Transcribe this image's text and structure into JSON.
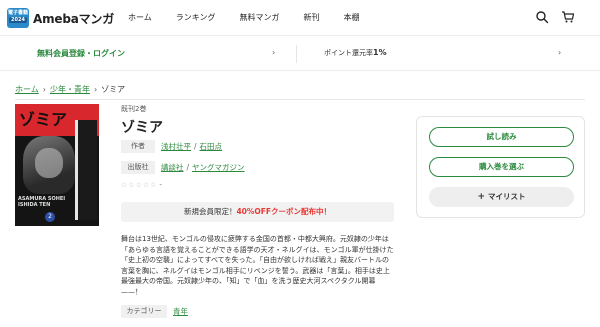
{
  "header": {
    "logo_badge_top": "電子書籍",
    "logo_badge_bottom": "2024",
    "logo_text": "Amebaマンガ",
    "nav": [
      "ホーム",
      "ランキング",
      "無料マンガ",
      "新刊",
      "本棚"
    ],
    "icons": [
      "search-icon",
      "cart-icon"
    ]
  },
  "promo": {
    "left": "無料会員登録・ログイン",
    "right_prefix": "ポイント還元率",
    "right_value": "1",
    "right_suffix": "%"
  },
  "breadcrumb": {
    "home": "ホーム",
    "category": "少年・青年",
    "current": "ゾミア"
  },
  "book": {
    "cover_title": "ゾミア",
    "cover_author_line1": "ASAMURA SOHEI",
    "cover_author_line2": "ISHIDA TEN",
    "cover_volume": "2",
    "volumes": "既刊2巻",
    "title": "ゾミア",
    "author_label": "作者",
    "author1": "浅村壮平",
    "author2": "石田点",
    "publisher_label": "出版社",
    "publisher": "講談社",
    "magazine": "ヤングマガジン",
    "stars": "☆☆☆☆☆",
    "rating": "-",
    "coupon_prefix": "新規会員限定！",
    "coupon_highlight": "40%OFFクーポン配布中！",
    "description": "舞台は13世紀、モンゴルの侵攻に疲弊する金国の首都・中都大興府。元奴隷の少年は「あらゆる言語を覚えることができる語学の天才・ネルグイは、モンゴル軍が仕掛けた「史上初の空襲」によってすべてを失った。「自由が欲しければ戦え」親友バートルの言葉を胸に、ネルグイはモンゴル相手にリベンジを誓う。武器は「言葉」。相手は史上最強最大の帝国。元奴隷少年の、「知」で「血」を洗う歴史大河スペクタクル開幕——！",
    "category_label": "カテゴリー",
    "category": "青年"
  },
  "actions": {
    "trial": "試し読み",
    "buy": "購入巻を選ぶ",
    "mylist": "マイリスト"
  },
  "colors": {
    "accent_green": "#2b8a3e",
    "coupon_red": "#e53935"
  }
}
